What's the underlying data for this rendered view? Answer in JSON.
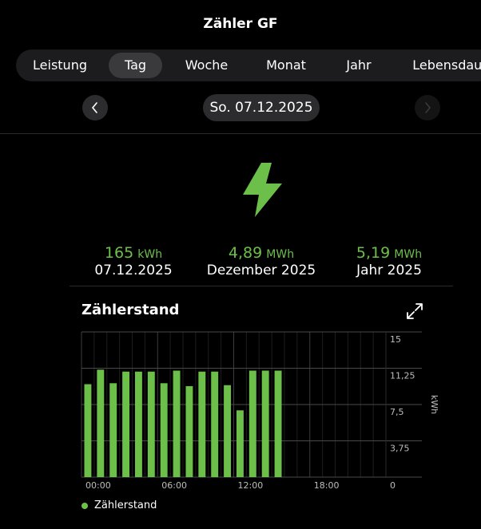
{
  "header": {
    "title": "Zähler GF"
  },
  "tabs": [
    {
      "label": "Leistung"
    },
    {
      "label": "Tag"
    },
    {
      "label": "Woche"
    },
    {
      "label": "Monat"
    },
    {
      "label": "Jahr"
    },
    {
      "label": "Lebensdauer"
    }
  ],
  "active_tab": "Tag",
  "date_nav": {
    "date": "So. 07.12.2025"
  },
  "stats": [
    {
      "value": "165",
      "unit": "kWh",
      "label": "07.12.2025"
    },
    {
      "value": "4,89",
      "unit": "MWh",
      "label": "Dezember 2025"
    },
    {
      "value": "5,19",
      "unit": "MWh",
      "label": "Jahr 2025"
    }
  ],
  "colors": {
    "accent": "#6cc04a",
    "background": "#000000",
    "pill": "#2c2c2e"
  },
  "icons": {
    "main": "lightning-bolt-icon",
    "expand": "expand-icon",
    "prev": "chevron-left-icon",
    "next": "chevron-right-icon"
  },
  "chart": {
    "title": "Zählerstand"
  },
  "chart_data": {
    "type": "bar",
    "title": "Zählerstand",
    "ylabel": "kWh",
    "ylim": [
      0,
      15
    ],
    "yticks": [
      "15",
      "11,25",
      "7,5",
      "3,75",
      "0"
    ],
    "xticks": [
      "00:00",
      "06:00",
      "12:00",
      "18:00"
    ],
    "categories": [
      "00:00",
      "01:00",
      "02:00",
      "03:00",
      "04:00",
      "05:00",
      "06:00",
      "07:00",
      "08:00",
      "09:00",
      "10:00",
      "11:00",
      "12:00",
      "13:00",
      "14:00",
      "15:00",
      "16:00",
      "17:00",
      "18:00",
      "19:00",
      "20:00",
      "21:00",
      "22:00",
      "23:00"
    ],
    "series": [
      {
        "name": "Zählerstand",
        "values": [
          9.6,
          11.1,
          9.7,
          10.9,
          10.9,
          10.9,
          9.7,
          11.0,
          9.4,
          10.9,
          10.9,
          9.5,
          6.9,
          11.0,
          11.0,
          11.0,
          null,
          null,
          null,
          null,
          null,
          null,
          null,
          null
        ]
      }
    ],
    "grid": true,
    "legend": "bottom-left"
  }
}
